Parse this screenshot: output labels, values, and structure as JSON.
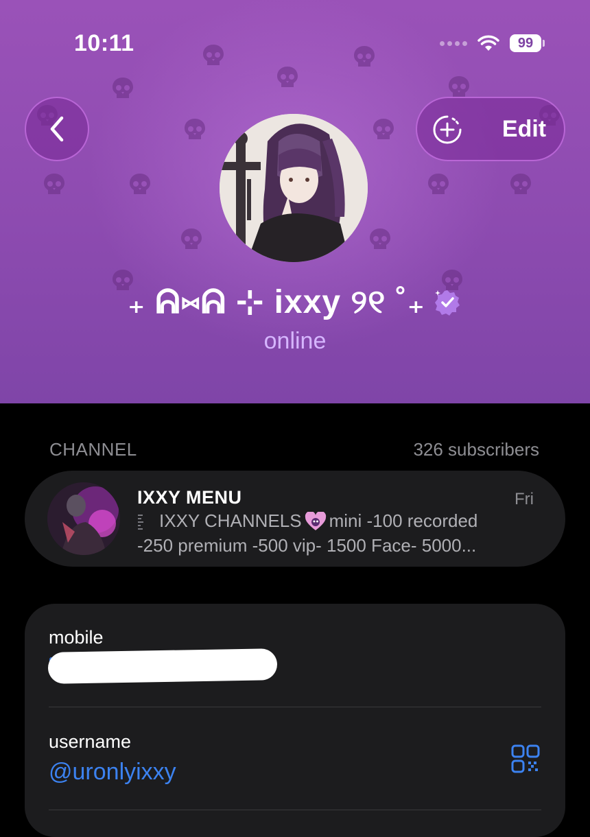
{
  "status_bar": {
    "time": "10:11",
    "battery": "99"
  },
  "header": {
    "edit_label": "Edit",
    "name": "₊ ᕱ⑅ᕱ ⊹ ixxy ୨୧ ˚₊",
    "status": "online"
  },
  "channel_section": {
    "label": "CHANNEL",
    "count": "326 subscribers",
    "channel": {
      "title": "IXXY MENU",
      "date": "Fri",
      "preview_line1_a": "IXXY CHANNELS",
      "preview_line1_b": "mini -100 recorded",
      "preview_line2": "-250 premium -500 vip- 1500 Face- 5000..."
    }
  },
  "info": {
    "mobile_label": "mobile",
    "username_label": "username",
    "username_value": "@uronlyixxy"
  },
  "colors": {
    "header_purple": "#9a52b8",
    "online_lilac": "#d6b6ff",
    "link_blue": "#3c82f0",
    "card_bg": "#1c1c1e"
  }
}
